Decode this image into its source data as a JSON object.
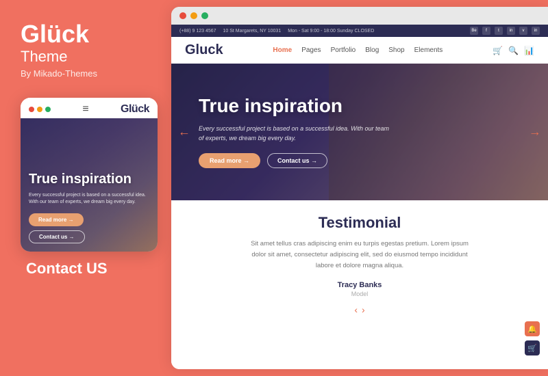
{
  "left": {
    "brand_title": "Glück",
    "brand_subtitle": "Theme",
    "brand_by": "By Mikado-Themes",
    "contact_us": "Contact US",
    "mobile": {
      "logo": "Glück",
      "hero_title": "True inspiration",
      "hero_text": "Every successful project is based on a successful idea. With our team of experts, we dream big every day.",
      "btn_read_more": "Read more →",
      "btn_contact": "Contact us →"
    }
  },
  "right": {
    "info_bar": {
      "phone": "(+88) 9 123 4567",
      "address": "10 St Margarets, NY 10031",
      "hours": "Mon - Sat 9:00 - 18:00 Sunday CLOSED",
      "socials": [
        "Be",
        "f",
        "t",
        "in",
        "v",
        "in"
      ]
    },
    "nav": {
      "logo": "Gluck",
      "links": [
        "Home",
        "Pages",
        "Portfolio",
        "Blog",
        "Shop",
        "Elements"
      ],
      "active": "Home"
    },
    "hero": {
      "title": "True inspiration",
      "text": "Every successful project is based on a successful idea. With our team of experts, we dream big every day.",
      "btn_read_more": "Read more →",
      "btn_contact": "Contact us →"
    },
    "testimonial": {
      "title": "Testimonial",
      "text": "Sit amet tellus cras adipiscing enim eu turpis egestas pretium. Lorem ipsum dolor sit amet, consectetur adipiscing elit, sed do eiusmod tempo incididunt labore et dolore magna aliqua.",
      "author": "Tracy Banks",
      "role": "Model"
    }
  },
  "colors": {
    "salmon": "#f07060",
    "dark_purple": "#2c2c54",
    "orange": "#e87050"
  }
}
